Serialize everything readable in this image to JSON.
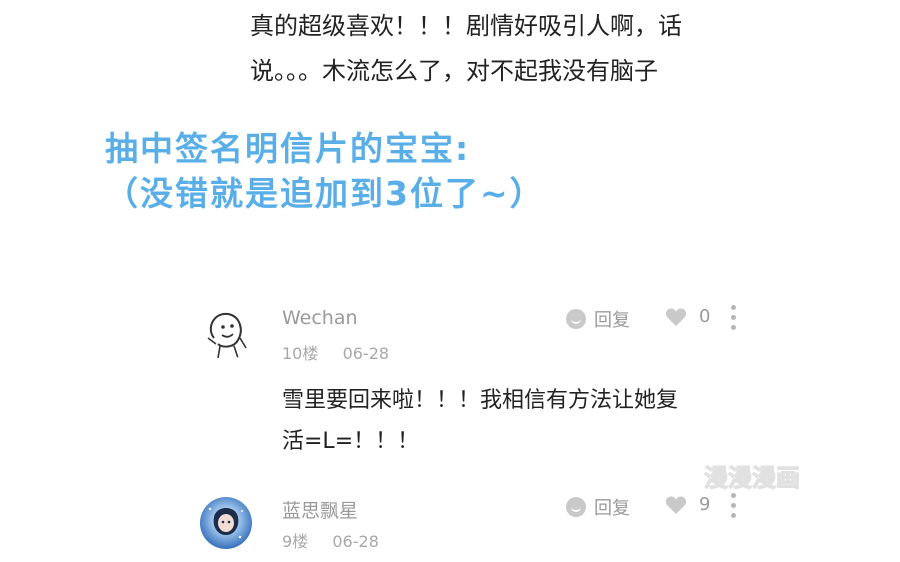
{
  "previous_comment": {
    "lines": [
      "真的超级喜欢！！！剧情好吸引人啊，话",
      "说。。。木流怎么了，对不起我没有脑子"
    ]
  },
  "announcement": {
    "lines": [
      "抽中签名明信片的宝宝:",
      "（没错就是追加到3位了~）"
    ],
    "color": "#5aaee8"
  },
  "comments": [
    {
      "username": "Wechan",
      "floor": "10楼",
      "date": "06-28",
      "reply_label": "回复",
      "likes": "0",
      "text_lines": [
        "雪里要回来啦！！！我相信有方法让她复",
        "活=L=！！！"
      ]
    },
    {
      "username": "蓝思飘星",
      "floor": "9楼",
      "date": "06-28",
      "reply_label": "回复",
      "likes": "9"
    }
  ],
  "watermark": {
    "text": "漫漫漫画"
  },
  "colors": {
    "muted": "#9a9a9a",
    "icon": "#c9c9c9"
  }
}
